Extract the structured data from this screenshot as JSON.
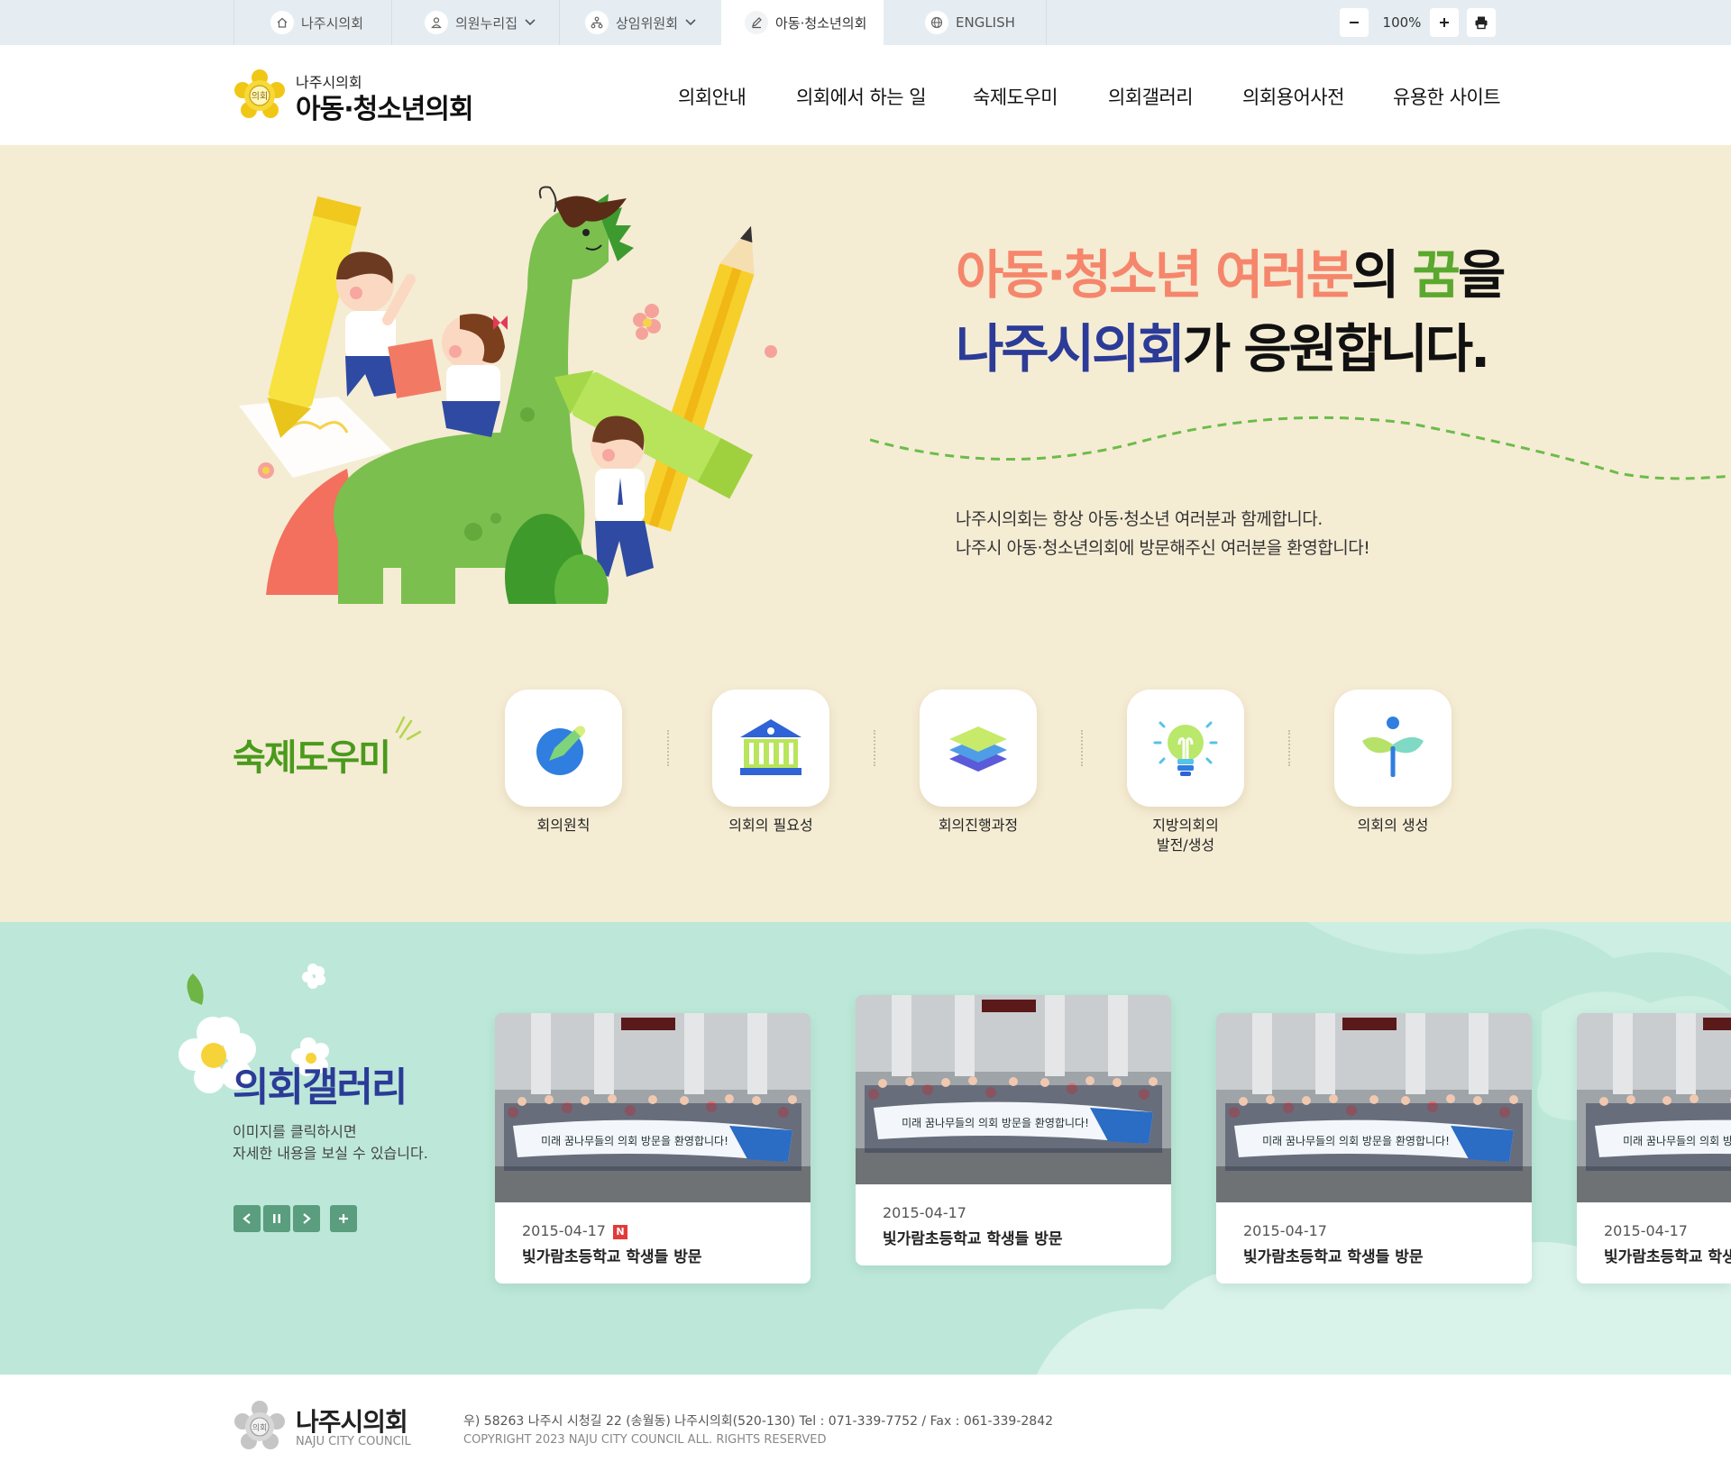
{
  "topbar": {
    "items": [
      {
        "label": "나주시의회",
        "icon": "home-icon",
        "has_chevron": false
      },
      {
        "label": "의원누리집",
        "icon": "person-icon",
        "has_chevron": true
      },
      {
        "label": "상임위원회",
        "icon": "org-chart-icon",
        "has_chevron": true
      },
      {
        "label": "아동·청소년의회",
        "icon": "pencil-icon",
        "has_chevron": false,
        "active": true
      },
      {
        "label": "ENGLISH",
        "icon": "globe-icon",
        "has_chevron": false
      }
    ],
    "zoom": {
      "minus": "−",
      "value": "100%",
      "plus": "+",
      "print_icon": "print-icon"
    }
  },
  "header": {
    "logo_small": "나주시의회",
    "logo_big": "아동·청소년의회",
    "emblem_text": "의회",
    "nav": [
      "의회안내",
      "의회에서 하는 일",
      "숙제도우미",
      "의회갤러리",
      "의회용어사전",
      "유용한 사이트"
    ]
  },
  "hero": {
    "line1": [
      {
        "text": "아동·청소년 여러분",
        "color": "#f5866c"
      },
      {
        "text": "의 ",
        "color": "#111111"
      },
      {
        "text": "꿈",
        "color": "#5aa82e"
      },
      {
        "text": "을",
        "color": "#111111"
      }
    ],
    "line2": [
      {
        "text": "나주시의회",
        "color": "#2b3b97"
      },
      {
        "text": "가 응원합니다.",
        "color": "#111111"
      }
    ],
    "desc": [
      "나주시의회는 항상 아동·청소년 여러분과 함께합니다.",
      "나주시 아동·청소년의회에 방문해주신 여러분을 환영합니다!"
    ]
  },
  "homework": {
    "title": "숙제도우미",
    "items": [
      {
        "label": "회의원칙",
        "icon": "pencil-circle-icon"
      },
      {
        "label": "의회의 필요성",
        "icon": "building-icon"
      },
      {
        "label": "회의진행과정",
        "icon": "layers-icon"
      },
      {
        "label": "지방의회의\n발전/생성",
        "icon": "lightbulb-icon"
      },
      {
        "label": "의회의 생성",
        "icon": "sprout-icon"
      }
    ]
  },
  "gallery": {
    "title": "의회갤러리",
    "desc": [
      "이미지를 클릭하시면",
      "자세한 내용을 보실 수 있습니다."
    ],
    "controls": [
      {
        "label": "‹",
        "icon": "prev-icon"
      },
      {
        "label": "II",
        "icon": "pause-icon"
      },
      {
        "label": "›",
        "icon": "next-icon"
      },
      {
        "label": "+",
        "icon": "more-icon"
      }
    ],
    "banner_text": "미래 꿈나무들의 의회 방문을 환영합니다!",
    "cards": [
      {
        "date": "2015-04-17",
        "title": "빛가람초등학교 학생들 방문",
        "new_badge": "N"
      },
      {
        "date": "2015-04-17",
        "title": "빛가람초등학교 학생들 방문"
      },
      {
        "date": "2015-04-17",
        "title": "빛가람초등학교 학생들 방문"
      },
      {
        "date": "2015-04-17",
        "title": "빛가람초등학교 학생들 방문"
      }
    ]
  },
  "footer": {
    "name": "나주시의회",
    "name_en": "NAJU CITY COUNCIL",
    "address": "우) 58263 나주시 시청길 22 (송월동) 나주시의회(520-130) Tel : 071-339-7752 / Fax : 061-339-2842",
    "copyright": "COPYRIGHT   2023 NAJU CITY COUNCIL ALL. RIGHTS RESERVED"
  },
  "colors": {
    "hero_bg": "#f5ecd4",
    "gallery_bg": "#bde8d9",
    "accent_green": "#4a9a1c",
    "accent_navy": "#2b3b97",
    "accent_coral": "#f5866c"
  }
}
